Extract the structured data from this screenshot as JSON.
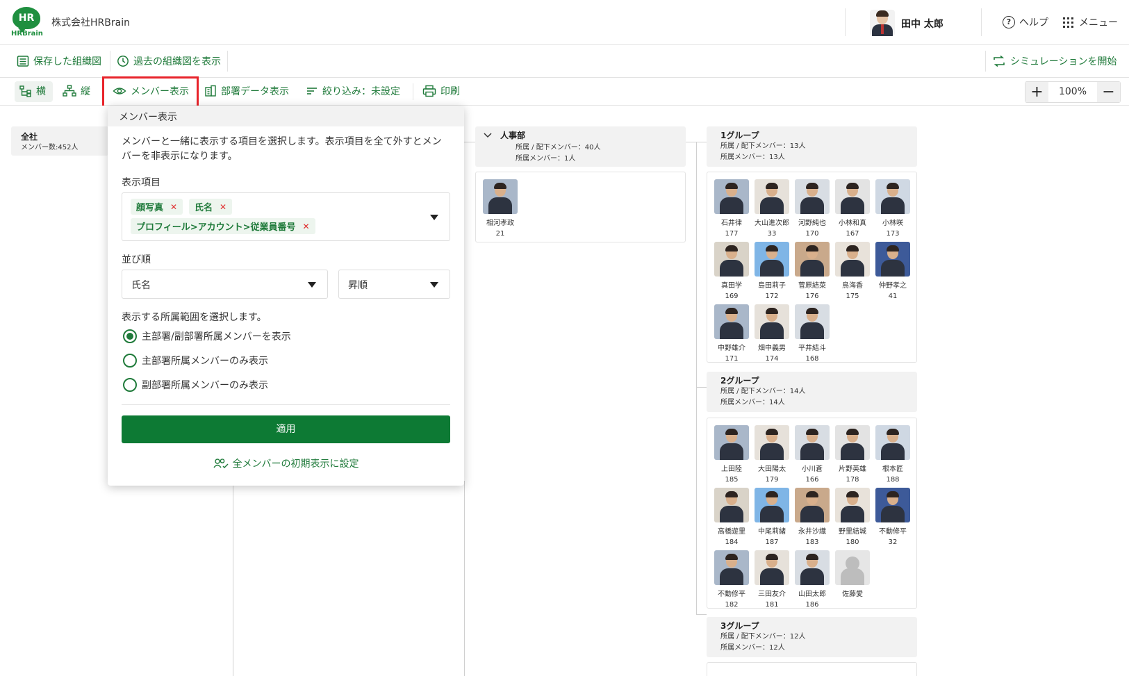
{
  "header": {
    "logo_text": "HR",
    "logo_sub": "HRBrain",
    "company": "株式会社HRBrain",
    "user_name": "田中 太郎",
    "help_label": "ヘルプ",
    "menu_label": "メニュー"
  },
  "toolbar1": {
    "saved_label": "保存した組織図",
    "past_label": "過去の組織図を表示",
    "simulation_label": "シミュレーションを開始"
  },
  "toolbar2": {
    "horizontal_label": "横",
    "vertical_label": "縦",
    "member_display_label": "メンバー表示",
    "dept_data_label": "部署データ表示",
    "filter_label": "絞り込み：未設定",
    "print_label": "印刷",
    "zoom_value": "100%"
  },
  "popover": {
    "title": "メンバー表示",
    "description": "メンバーと一緒に表示する項目を選択します。表示項目を全て外すとメンバーを非表示になります。",
    "display_items_label": "表示項目",
    "tags": [
      "顔写真",
      "氏名",
      "プロフィール>アカウント>従業員番号"
    ],
    "sort_label": "並び順",
    "sort_field": "氏名",
    "sort_order": "昇順",
    "scope_label": "表示する所属範囲を選択します。",
    "scope_options": [
      "主部署/副部署所属メンバーを表示",
      "主部署所属メンバーのみ表示",
      "副部署所属メンバーのみ表示"
    ],
    "apply_label": "適用",
    "reset_label": "全メンバーの初期表示に設定"
  },
  "org": {
    "root": {
      "title": "全社",
      "sub": "メンバー数:452人"
    },
    "hr": {
      "title": "人事部",
      "sub1": "所属 / 配下メンバー：40人",
      "sub2": "所属メンバー：1人",
      "members": [
        {
          "name": "相河孝政",
          "num": "21"
        }
      ]
    },
    "group1": {
      "title": "1グループ",
      "sub1": "所属 / 配下メンバー：13人",
      "sub2": "所属メンバー：13人",
      "members": [
        {
          "name": "石井律",
          "num": "177"
        },
        {
          "name": "大山進次郎",
          "num": "33"
        },
        {
          "name": "河野純也",
          "num": "170"
        },
        {
          "name": "小林和真",
          "num": "167"
        },
        {
          "name": "小林咲",
          "num": "173"
        },
        {
          "name": "真田学",
          "num": "169"
        },
        {
          "name": "島田莉子",
          "num": "172"
        },
        {
          "name": "菅原結菜",
          "num": "176"
        },
        {
          "name": "鳥海香",
          "num": "175"
        },
        {
          "name": "仲野孝之",
          "num": "41"
        },
        {
          "name": "中野雄介",
          "num": "171"
        },
        {
          "name": "畑中義男",
          "num": "174"
        },
        {
          "name": "平井結斗",
          "num": "168"
        }
      ]
    },
    "group2": {
      "title": "2グループ",
      "sub1": "所属 / 配下メンバー：14人",
      "sub2": "所属メンバー：14人",
      "members": [
        {
          "name": "上田陸",
          "num": "185"
        },
        {
          "name": "大田陽太",
          "num": "179"
        },
        {
          "name": "小川蒼",
          "num": "166"
        },
        {
          "name": "片野英雄",
          "num": "178"
        },
        {
          "name": "根本匠",
          "num": "188"
        },
        {
          "name": "高橋遊里",
          "num": "184"
        },
        {
          "name": "中尾莉緒",
          "num": "187"
        },
        {
          "name": "永井沙織",
          "num": "183"
        },
        {
          "name": "野里結城",
          "num": "180"
        },
        {
          "name": "不動修平",
          "num": "32"
        },
        {
          "name": "不動修平",
          "num": "182"
        },
        {
          "name": "三田友介",
          "num": "181"
        },
        {
          "name": "山田太郎",
          "num": "186"
        },
        {
          "name": "佐藤愛",
          "num": ""
        }
      ]
    },
    "group3": {
      "title": "3グループ",
      "sub1": "所属 / 配下メンバー：12人",
      "sub2": "所属メンバー：12人"
    }
  },
  "colors": {
    "accent": "#1f7a3a",
    "apply_bg": "#0d7a34",
    "highlight": "#e8232a"
  }
}
